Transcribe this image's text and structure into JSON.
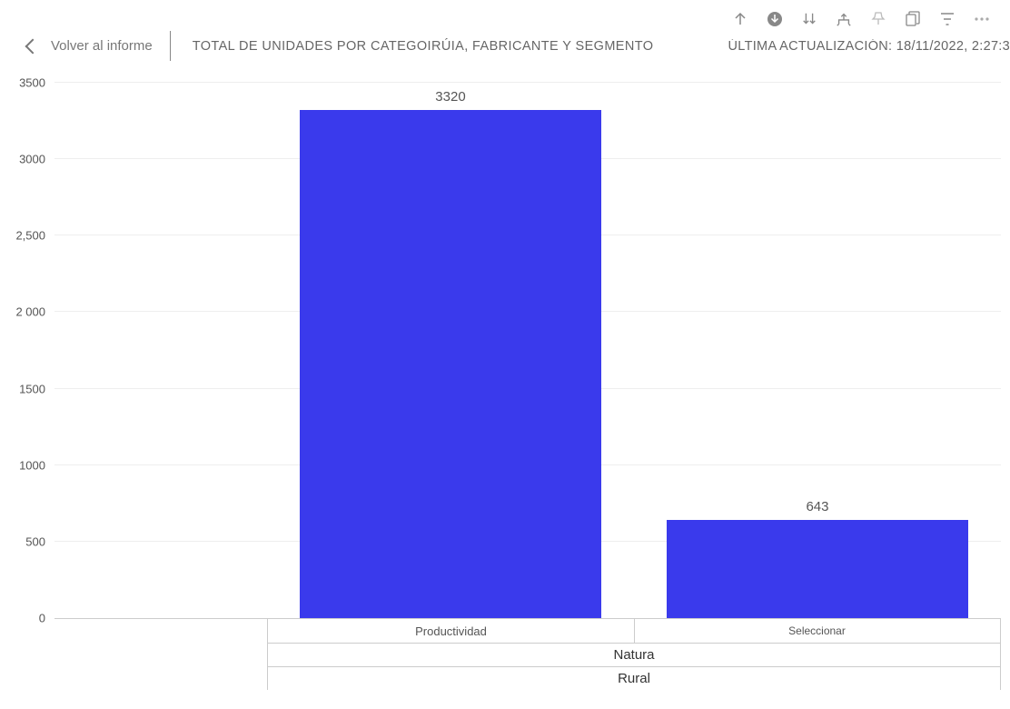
{
  "toolbar": {
    "icons": [
      "arrow-up",
      "arrow-down-circle",
      "sort",
      "hierarchy",
      "pin",
      "copy",
      "filter",
      "more"
    ]
  },
  "header": {
    "back_label": "Volver al informe",
    "title": "TOTAL DE UNIDADES POR CATEGOIRÚIA, FABRICANTE Y SEGMENTO",
    "last_update_prefix": "ÚLTIMA ACTUALIZACIÓN:",
    "last_update_value": "18/11/2022, 2:27:3"
  },
  "chart_data": {
    "type": "bar",
    "categories": [
      "Productividad",
      "Seleccionar"
    ],
    "values": [
      3320,
      643
    ],
    "group1": "Natura",
    "group2": "Rural",
    "ylim": [
      0,
      3500
    ],
    "y_ticks": [
      {
        "v": 0,
        "label": "0"
      },
      {
        "v": 500,
        "label": "500"
      },
      {
        "v": 1000,
        "label": "1000"
      },
      {
        "v": 1500,
        "label": "1500"
      },
      {
        "v": 2000,
        "label": "2 000"
      },
      {
        "v": 2500,
        "label": "2,500"
      },
      {
        "v": 3000,
        "label": "3000"
      },
      {
        "v": 3500,
        "label": "3500"
      }
    ],
    "bar_color": "#3a3aec"
  }
}
